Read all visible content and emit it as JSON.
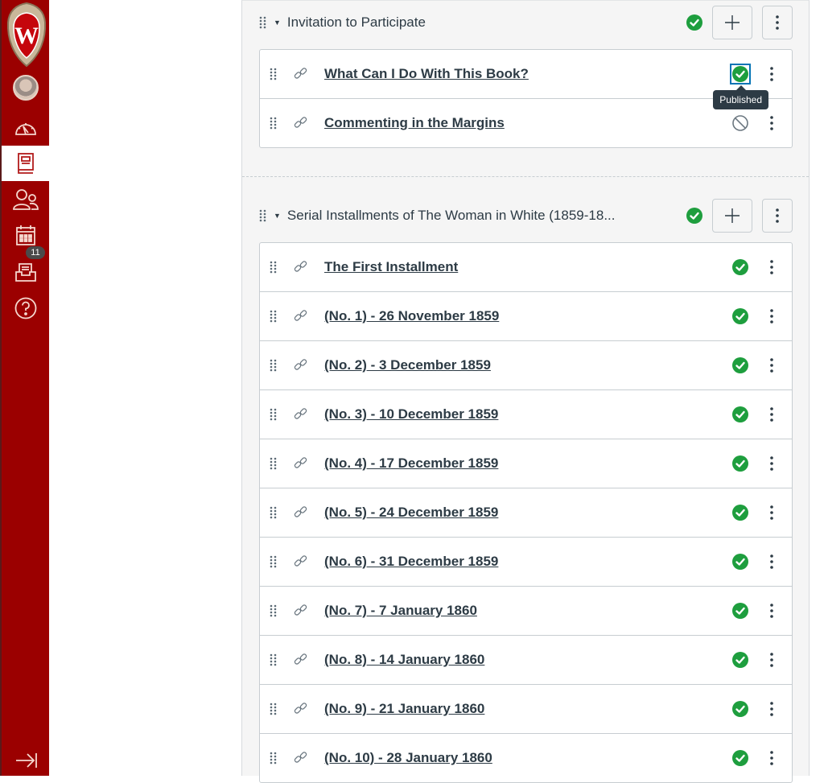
{
  "global_nav": {
    "logo": "university-crest",
    "items": [
      {
        "name": "account",
        "icon": "avatar"
      },
      {
        "name": "dashboard",
        "icon": "dashboard-icon"
      },
      {
        "name": "courses",
        "icon": "courses-icon",
        "active": true
      },
      {
        "name": "groups",
        "icon": "groups-icon"
      },
      {
        "name": "calendar",
        "icon": "calendar-icon"
      },
      {
        "name": "inbox",
        "icon": "inbox-icon",
        "badge": "11"
      },
      {
        "name": "help",
        "icon": "help-icon"
      }
    ],
    "collapse_icon": "collapse-nav-icon"
  },
  "colors": {
    "brand": "#9b0000",
    "published": "#1e9e3e",
    "text": "#2d3b45",
    "focus": "#0374b5"
  },
  "modules": [
    {
      "title": "Invitation to Participate",
      "status": "published",
      "items": [
        {
          "title": "What Can I Do With This Book?",
          "type": "link",
          "status": "published",
          "tooltip": "Published"
        },
        {
          "title": "Commenting in the Margins",
          "type": "link",
          "status": "unpublished"
        }
      ]
    },
    {
      "title": "Serial Installments of The Woman in White (1859-18...",
      "status": "published",
      "items": [
        {
          "title": "The First Installment",
          "type": "link",
          "status": "published"
        },
        {
          "title": "(No. 1) - 26 November 1859",
          "type": "link",
          "status": "published"
        },
        {
          "title": "(No. 2) - 3 December 1859",
          "type": "link",
          "status": "published"
        },
        {
          "title": "(No. 3) - 10 December 1859",
          "type": "link",
          "status": "published"
        },
        {
          "title": "(No. 4) - 17 December 1859",
          "type": "link",
          "status": "published"
        },
        {
          "title": "(No. 5) - 24 December 1859",
          "type": "link",
          "status": "published"
        },
        {
          "title": "(No. 6) - 31 December 1859",
          "type": "link",
          "status": "published"
        },
        {
          "title": "(No. 7) - 7 January 1860",
          "type": "link",
          "status": "published"
        },
        {
          "title": "(No. 8) - 14 January 1860",
          "type": "link",
          "status": "published"
        },
        {
          "title": "(No. 9) - 21 January 1860",
          "type": "link",
          "status": "published"
        },
        {
          "title": "(No. 10) - 28 January 1860",
          "type": "link",
          "status": "published"
        }
      ]
    }
  ]
}
